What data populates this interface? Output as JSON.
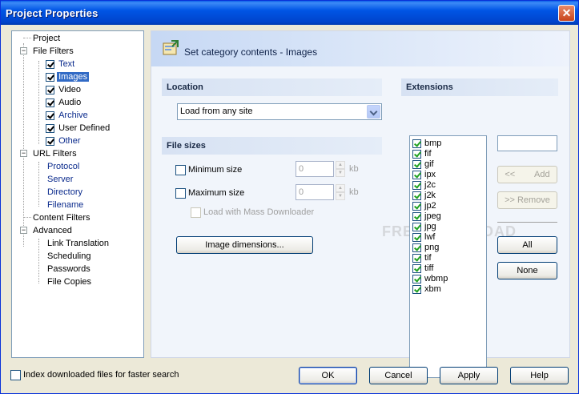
{
  "window": {
    "title": "Project Properties"
  },
  "tree": {
    "project": "Project",
    "file_filters": "File Filters",
    "file_filter_items": [
      {
        "label": "Text",
        "checked": true
      },
      {
        "label": "Images",
        "checked": true,
        "selected": true
      },
      {
        "label": "Video",
        "checked": true
      },
      {
        "label": "Audio",
        "checked": true
      },
      {
        "label": "Archive",
        "checked": true
      },
      {
        "label": "User Defined",
        "checked": true
      },
      {
        "label": "Other",
        "checked": true
      }
    ],
    "url_filters": "URL Filters",
    "url_filter_items": [
      "Protocol",
      "Server",
      "Directory",
      "Filename"
    ],
    "content_filters": "Content Filters",
    "advanced": "Advanced",
    "advanced_items": [
      "Link Translation",
      "Scheduling",
      "Passwords",
      "File Copies"
    ]
  },
  "header": {
    "title": "Set category contents - Images"
  },
  "location": {
    "heading": "Location",
    "selected": "Load from any site"
  },
  "file_sizes": {
    "heading": "File sizes",
    "minimum_label": "Minimum size",
    "minimum_value": "0",
    "maximum_label": "Maximum size",
    "maximum_value": "0",
    "unit": "kb",
    "mass_downloader_label": "Load with Mass Downloader",
    "image_dimensions_button": "Image dimensions..."
  },
  "extensions": {
    "heading": "Extensions",
    "items": [
      "bmp",
      "fif",
      "gif",
      "ipx",
      "j2c",
      "j2k",
      "jp2",
      "jpeg",
      "jpg",
      "lwf",
      "png",
      "tif",
      "tiff",
      "wbmp",
      "xbm"
    ],
    "input_value": "",
    "add_button": "<<        Add",
    "remove_button": ">> Remove",
    "all_button": "All",
    "none_button": "None"
  },
  "watermark": "FREEDOWNLOAD",
  "bottom": {
    "index_label": "Index downloaded files for faster search",
    "ok": "OK",
    "cancel": "Cancel",
    "apply": "Apply",
    "help": "Help"
  },
  "colors": {
    "title_bar": "#0055e5",
    "selection": "#316ac5",
    "link_blue": "#0a2a8c"
  }
}
